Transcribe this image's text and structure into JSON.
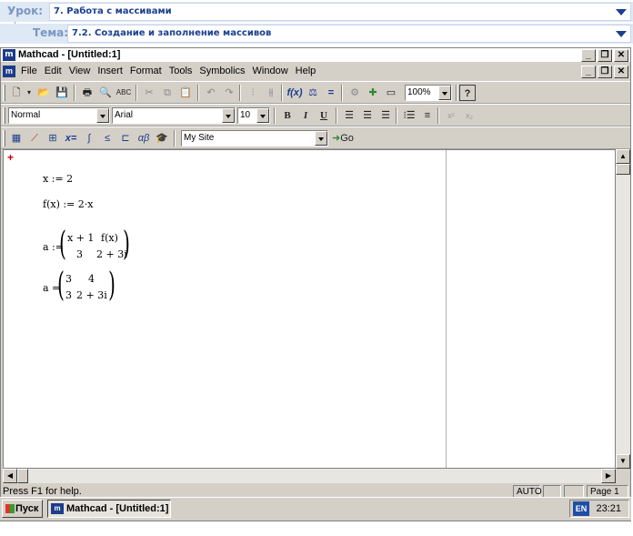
{
  "lesson": {
    "label1": "Урок:",
    "value1": "7. Работа с массивами",
    "label2": "Тема:",
    "value2": "7.2. Создание и заполнение массивов"
  },
  "window": {
    "title": "Mathcad - [Untitled:1]",
    "icon_text": "m"
  },
  "menu": {
    "items": [
      "File",
      "Edit",
      "View",
      "Insert",
      "Format",
      "Tools",
      "Symbolics",
      "Window",
      "Help"
    ]
  },
  "toolbar": {
    "zoom": "100%",
    "style": "Normal",
    "font": "Arial",
    "size": "10",
    "bold": "B",
    "italic": "I",
    "underline": "U",
    "site": "My Site",
    "go": "Go"
  },
  "document": {
    "line1": "x := 2",
    "line2": "f(x) := 2·x",
    "def_lhs": "a :=",
    "def_cells": [
      "x + 1",
      "f(x)",
      "3",
      "2 + 3i"
    ],
    "eval_lhs": "a =",
    "eval_cells": [
      "3",
      "4",
      "3",
      "2 + 3i"
    ]
  },
  "status": {
    "help": "Press F1 for help.",
    "mode": "AUTO",
    "page": "Page 1"
  },
  "taskbar": {
    "start": "Пуск",
    "task": "Mathcad - [Untitled:1]",
    "lang": "EN",
    "time": "23:21"
  }
}
